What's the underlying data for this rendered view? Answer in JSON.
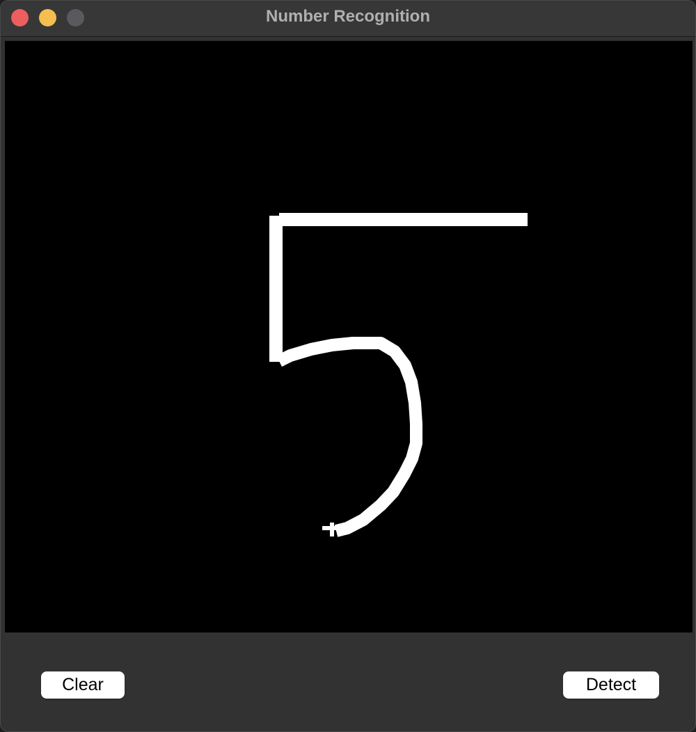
{
  "window": {
    "title": "Number Recognition",
    "controls": {
      "close_color": "#ec5f5e",
      "minimize_color": "#f4bf4f",
      "zoom_color": "#5a5a5e"
    }
  },
  "canvas": {
    "background": "#000000",
    "stroke_color": "#ffffff",
    "drawn_content": "handwritten digit 5"
  },
  "buttons": {
    "clear_label": "Clear",
    "detect_label": "Detect"
  }
}
